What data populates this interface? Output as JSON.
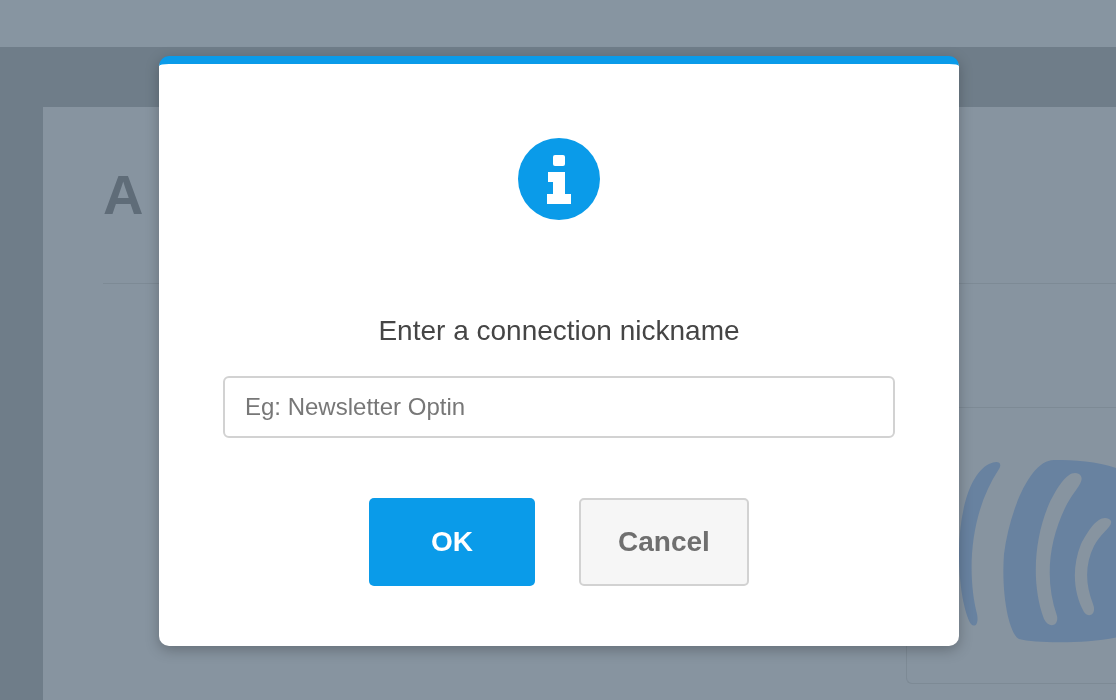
{
  "background": {
    "heading": "A"
  },
  "dialog": {
    "title": "Enter a connection nickname",
    "input": {
      "placeholder": "Eg: Newsletter Optin"
    },
    "buttons": [
      {
        "label": "OK",
        "kind": "primary"
      },
      {
        "label": "Cancel",
        "kind": "secondary"
      }
    ]
  }
}
